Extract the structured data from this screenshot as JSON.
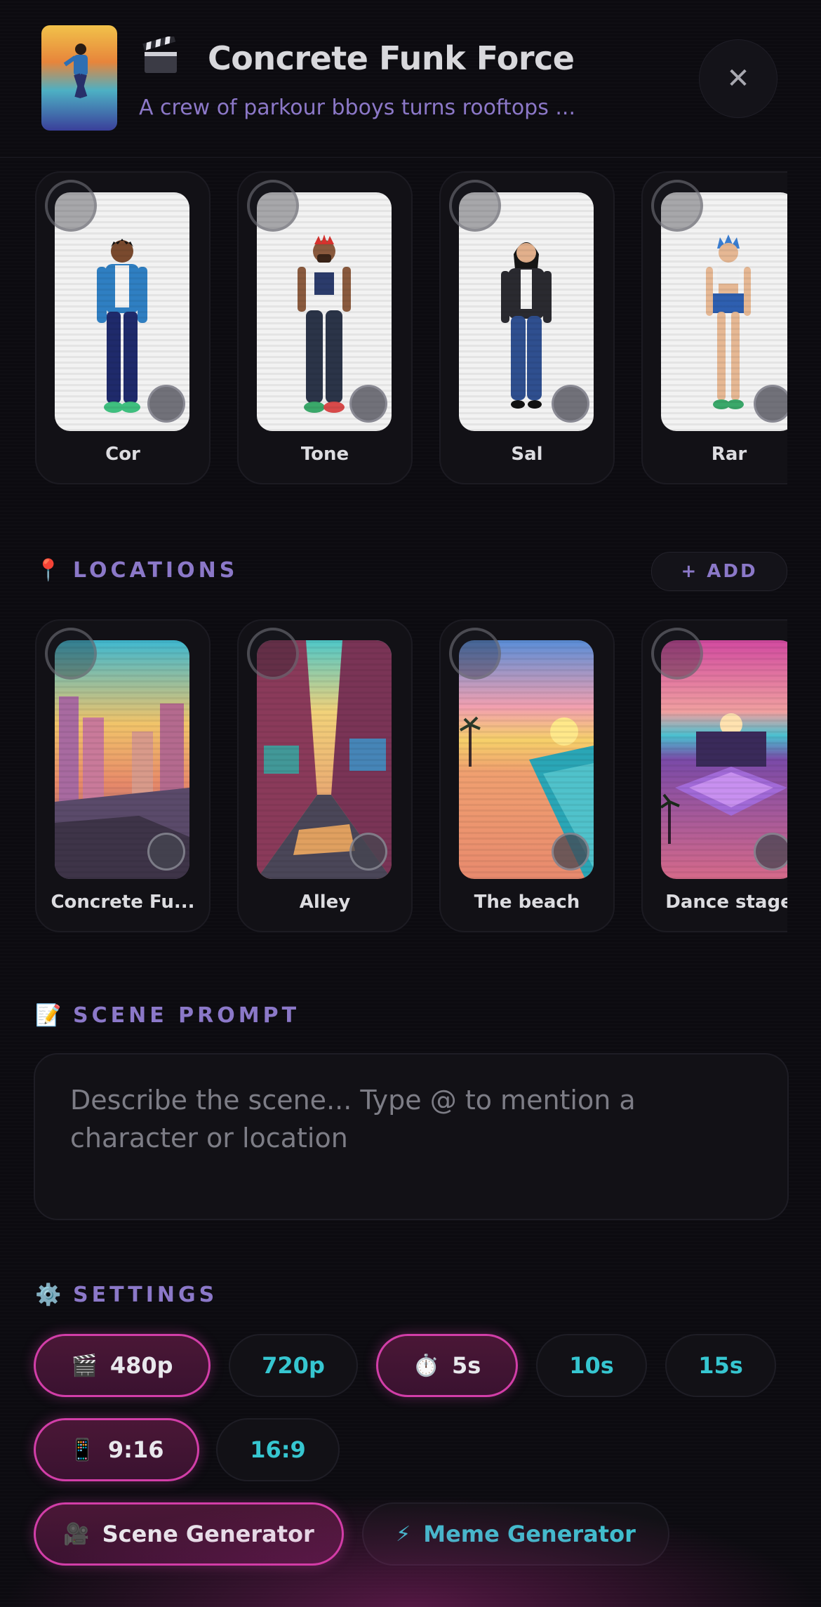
{
  "header": {
    "title": "Concrete Funk Force",
    "subtitle": "A crew of parkour bboys turns rooftops ...",
    "close_glyph": "✕"
  },
  "characters": [
    {
      "name": "Cor"
    },
    {
      "name": "Tone"
    },
    {
      "name": "Sal"
    },
    {
      "name": "Rar"
    }
  ],
  "locations_section": {
    "icon": "📍",
    "title": "LOCATIONS",
    "add_label": "+ ADD",
    "items": [
      {
        "name": "Concrete Fu..."
      },
      {
        "name": "Alley"
      },
      {
        "name": "The beach"
      },
      {
        "name": "Dance stage"
      }
    ]
  },
  "prompt_section": {
    "icon": "📝",
    "title": "SCENE PROMPT",
    "placeholder": "Describe the scene... Type @ to mention a character or location"
  },
  "settings_section": {
    "icon": "⚙️",
    "title": "SETTINGS",
    "resolution": [
      {
        "label": "480p",
        "icon": "🎬",
        "selected": true
      },
      {
        "label": "720p",
        "selected": false
      }
    ],
    "duration": [
      {
        "label": "5s",
        "icon": "⏱️",
        "selected": true
      },
      {
        "label": "10s",
        "selected": false
      },
      {
        "label": "15s",
        "selected": false
      }
    ],
    "aspect": [
      {
        "label": "9:16",
        "icon": "📱",
        "selected": true
      },
      {
        "label": "16:9",
        "selected": false
      }
    ],
    "modes": [
      {
        "label": "Scene Generator",
        "icon": "🎥",
        "selected": true
      },
      {
        "label": "Meme Generator",
        "icon": "⚡",
        "selected": false
      }
    ]
  },
  "colors": {
    "background": "#0c0b10",
    "accent_pink": "#d23ea8",
    "accent_cyan": "#36c6d0",
    "section_purple": "#8b78c8"
  }
}
